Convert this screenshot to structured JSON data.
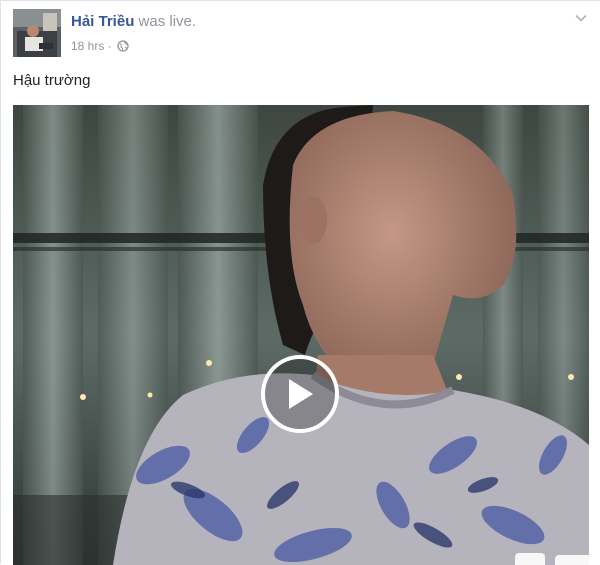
{
  "post": {
    "author": "Hải Triều",
    "action": " was live.",
    "timestamp": "18 hrs",
    "separator": " · ",
    "privacy_icon": "globe-icon",
    "menu_icon": "chevron-down-icon",
    "text": "Hậu trường"
  },
  "video": {
    "play_icon": "play-icon",
    "is_live_replay": true
  },
  "colors": {
    "author_link": "#365899",
    "meta_text": "#90949c",
    "body_text": "#1d2129"
  }
}
